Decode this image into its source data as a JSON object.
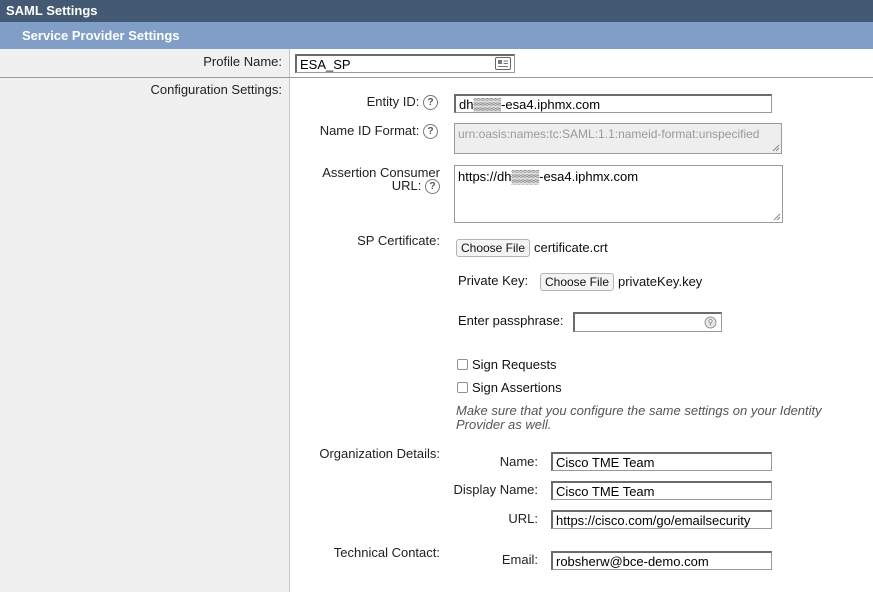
{
  "window": {
    "title": "SAML Settings"
  },
  "section": {
    "title": "Service Provider Settings"
  },
  "profile": {
    "label": "Profile Name:",
    "value": "ESA_SP"
  },
  "config": {
    "label": "Configuration Settings:"
  },
  "entity_id": {
    "label": "Entity ID:",
    "value": "dh▒▒▒-esa4.iphmx.com"
  },
  "name_id_format": {
    "label": "Name ID Format:",
    "value": "urn:oasis:names:tc:SAML:1.1:nameid-format:unspecified"
  },
  "acs_url": {
    "label_line1": "Assertion Consumer",
    "label_line2": "URL:",
    "value": "https://dh▒▒▒-esa4.iphmx.com"
  },
  "sp_cert": {
    "label": "SP Certificate:",
    "button": "Choose File",
    "file": "certificate.crt"
  },
  "private_key": {
    "label": "Private Key:",
    "button": "Choose File",
    "file": "privateKey.key"
  },
  "passphrase": {
    "label": "Enter passphrase:",
    "value": ""
  },
  "sign_requests": {
    "label": "Sign Requests",
    "checked": false
  },
  "sign_assertions": {
    "label": "Sign Assertions",
    "checked": false
  },
  "note": {
    "line1": "Make sure that you configure the same settings on your Identity",
    "line2": "Provider as well."
  },
  "org": {
    "label": "Organization Details:",
    "name_label": "Name:",
    "name_value": "Cisco TME Team",
    "display_label": "Display Name:",
    "display_value": "Cisco TME Team",
    "url_label": "URL:",
    "url_value": "https://cisco.com/go/emailsecurity"
  },
  "tech": {
    "label": "Technical Contact:",
    "email_label": "Email:",
    "email_value": "robsherw@bce-demo.com"
  },
  "help_glyph": "?",
  "colors": {
    "titlebar": "#445a74",
    "sectionbar": "#819ec7",
    "leftcol": "#f0f0f0"
  }
}
